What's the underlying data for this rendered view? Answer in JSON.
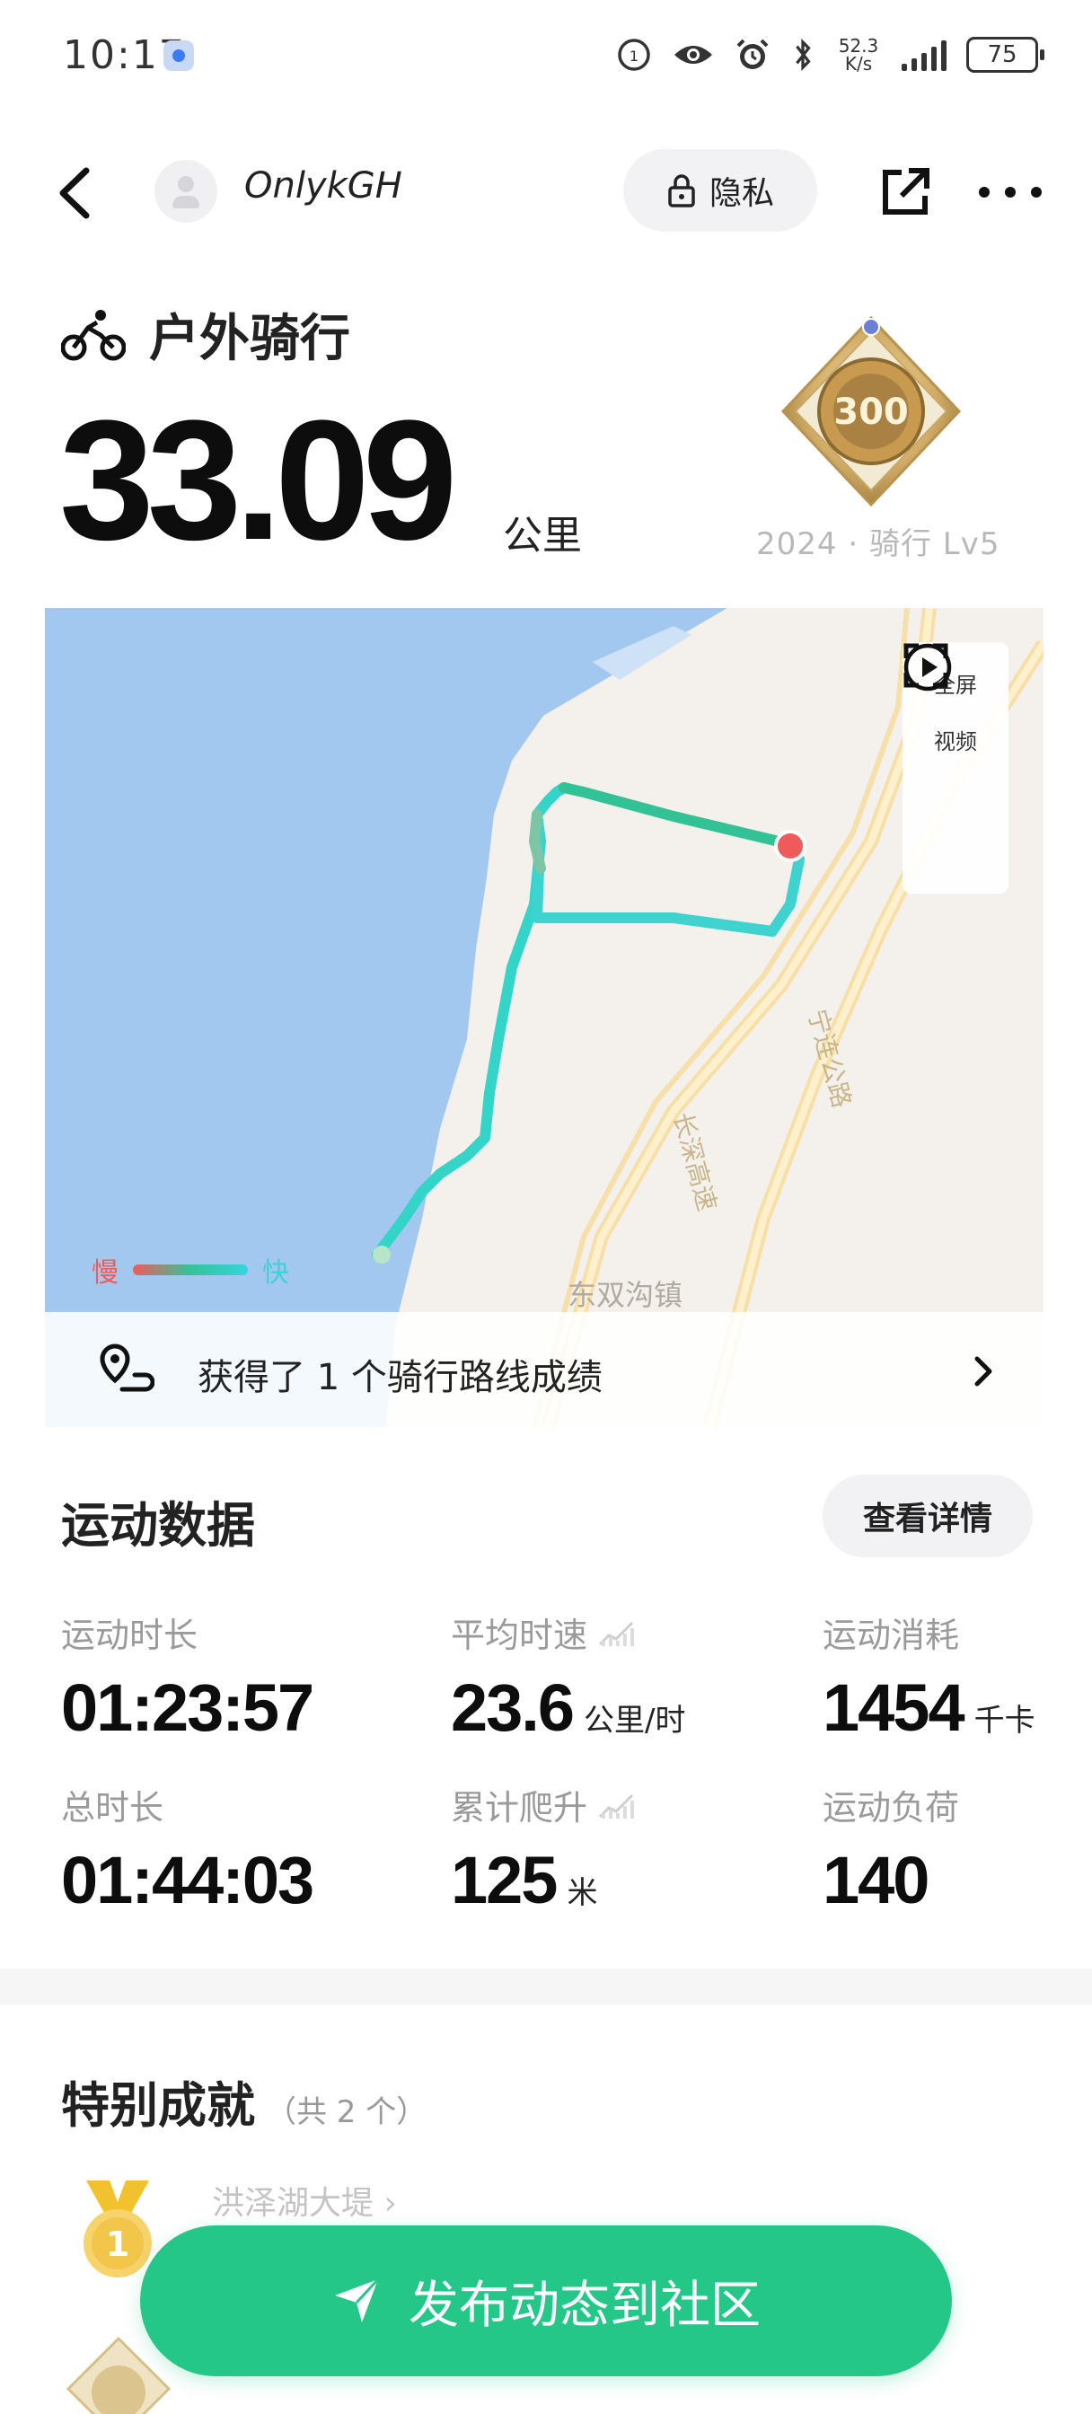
{
  "status_bar": {
    "time": "10:17",
    "network_speed_value": "52.3",
    "network_speed_unit": "K/s",
    "battery": "75"
  },
  "nav": {
    "username": "OnlykGH",
    "privacy_label": "隐私"
  },
  "workout": {
    "sport_name": "户外骑行",
    "distance": "33.09",
    "distance_unit": "公里",
    "medal_number": "300",
    "medal_caption": "2024 · 骑行 Lv5"
  },
  "map": {
    "fullscreen_label": "全屏",
    "video_label": "视频",
    "legend_slow": "慢",
    "legend_fast": "快",
    "town_label": "东双沟镇",
    "road_label_1": "宁连公路",
    "road_label_2": "长深高速",
    "achievement_text": "获得了 1 个骑行路线成绩"
  },
  "stats_section": {
    "title": "运动数据",
    "detail_button": "查看详情",
    "items": [
      {
        "label": "运动时长",
        "value": "01:23:57",
        "unit": ""
      },
      {
        "label": "平均时速",
        "value": "23.6",
        "unit": "公里/时"
      },
      {
        "label": "运动消耗",
        "value": "1454",
        "unit": "千卡"
      },
      {
        "label": "总时长",
        "value": "01:44:03",
        "unit": ""
      },
      {
        "label": "累计爬升",
        "value": "125",
        "unit": "米"
      },
      {
        "label": "运动负荷",
        "value": "140",
        "unit": ""
      }
    ]
  },
  "achievements": {
    "title": "特别成就",
    "count": "（共 2 个）",
    "first_item": "洪泽湖大堤 ›",
    "gold_number": "1"
  },
  "publish_button": "发布动态到社区",
  "colors": {
    "accent_green": "#25c789",
    "route_fast": "#35d4e0",
    "route_slow": "#ef5b5b",
    "water": "#a3c8f0"
  }
}
